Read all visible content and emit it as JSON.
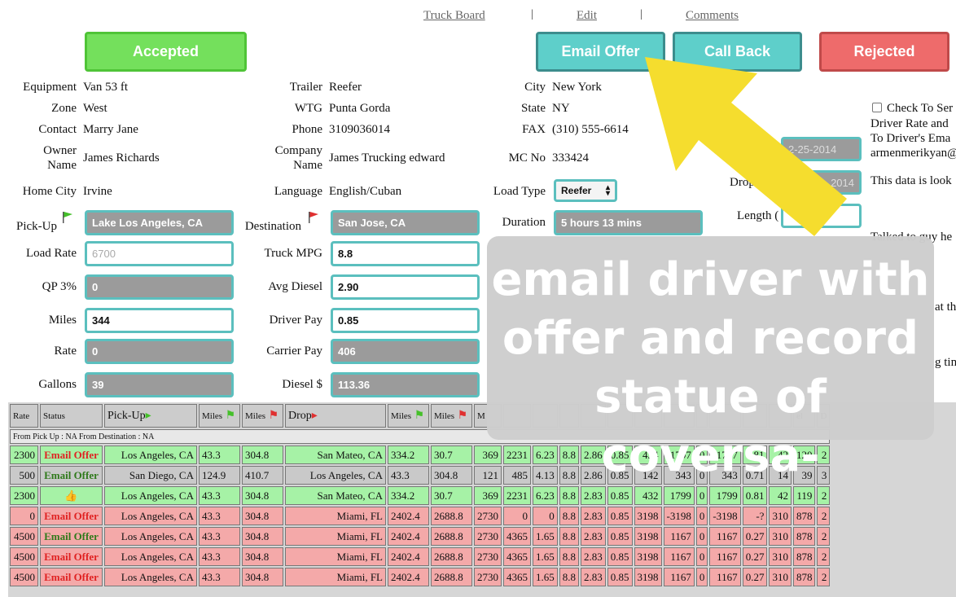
{
  "nav": {
    "truck_board": "Truck Board",
    "edit": "Edit",
    "comments": "Comments",
    "sep": "|"
  },
  "buttons": {
    "accepted": "Accepted",
    "email_offer": "Email Offer",
    "call_back": "Call Back",
    "rejected": "Rejected"
  },
  "colors": {
    "accepted": "#74e05c",
    "teal": "#5ecfca",
    "rejected": "#ee6b6b",
    "arrow": "#f5dd2e"
  },
  "details": {
    "equipment_label": "Equipment",
    "equipment": "Van 53 ft",
    "zone_label": "Zone",
    "zone": "West",
    "contact_label": "Contact",
    "contact": "Marry Jane",
    "owner_label_1": "Owner",
    "owner_label_2": "Name",
    "owner": "James Richards",
    "home_city_label": "Home City",
    "home_city": "Irvine",
    "trailer_label": "Trailer",
    "trailer": "Reefer",
    "wtg_label": "WTG",
    "wtg": "Punta Gorda",
    "phone_label": "Phone",
    "phone": "3109036014",
    "company_label_1": "Company",
    "company_label_2": "Name",
    "company": "James Trucking edward",
    "language_label": "Language",
    "language": "English/Cuban",
    "city_label": "City",
    "city": "New York",
    "state_label": "State",
    "state": "NY",
    "fax_label": "FAX",
    "fax": "(310) 555-6614",
    "mc_label": "MC No",
    "mc": "333424",
    "load_type_label": "Load Type",
    "load_type": "Reefer"
  },
  "form": {
    "pickup_label": "Pick-Up",
    "pickup": "Lake Los Angeles, CA",
    "destination_label": "Destination",
    "destination": "San Jose, CA",
    "duration_label": "Duration",
    "duration": "5 hours 13 mins",
    "load_rate_label": "Load Rate",
    "load_rate_placeholder": "6700",
    "qp_label": "QP 3%",
    "qp": "0",
    "miles_label": "Miles",
    "miles": "344",
    "rate_label": "Rate",
    "rate": "0",
    "gallons_label": "Gallons",
    "gallons": "39",
    "truck_mpg_label": "Truck MPG",
    "truck_mpg": "8.8",
    "avg_diesel_label": "Avg Diesel",
    "avg_diesel": "2.90",
    "driver_pay_label": "Driver Pay",
    "driver_pay": "0.85",
    "carrier_pay_label": "Carrier Pay",
    "carrier_pay": "406",
    "diesel_label": "Diesel $",
    "diesel": "113.36"
  },
  "right_panel": {
    "check_label": "Check To Ser",
    "line2": "Driver Rate and",
    "line3": "To Driver's Ema",
    "line4": "armenmerikyan@",
    "pickup_date": "2-25-2014",
    "drop_label": "Drop",
    "drop_date": "2014",
    "note1": "This data is look",
    "length_label": "Length (",
    "talked": "Talked to guy he",
    "at_th": "at th",
    "g_tim": "g tim"
  },
  "overlay": {
    "line1": "email driver with",
    "line2": "offer and record",
    "line3": "statue of coversa-"
  },
  "table": {
    "headers": [
      "Rate",
      "Status",
      "Pick-Up",
      "Miles",
      "Miles",
      "Drop",
      "Miles",
      "Miles",
      "M",
      "",
      "",
      "",
      "",
      "",
      "",
      "",
      "",
      "",
      "",
      "",
      "el",
      "D"
    ],
    "info": "From Pick Up : NA From Destination : NA",
    "rows": [
      {
        "cls": "green",
        "rate": "2300",
        "status": "Email Offer",
        "st": "red",
        "pickup": "Los Angeles, CA",
        "m1": "43.3",
        "m2": "304.8",
        "drop": "San Mateo, CA",
        "m3": "334.2",
        "m4": "30.7",
        "c1": "369",
        "c2": "2231",
        "c3": "6.23",
        "c4": "8.8",
        "c5": "2.86",
        "c6": "0.85",
        "c7": "434",
        "c8": "1797",
        "c9": "0",
        "c10": "1797",
        "c11": "0.81",
        "c12": "42",
        "c13": "120",
        "c14": "2"
      },
      {
        "cls": "gray",
        "rate": "500",
        "status": "Email Offer",
        "st": "green",
        "pickup": "San Diego, CA",
        "m1": "124.9",
        "m2": "410.7",
        "drop": "Los Angeles, CA",
        "m3": "43.3",
        "m4": "304.8",
        "c1": "121",
        "c2": "485",
        "c3": "4.13",
        "c4": "8.8",
        "c5": "2.86",
        "c6": "0.85",
        "c7": "142",
        "c8": "343",
        "c9": "0",
        "c10": "343",
        "c11": "0.71",
        "c12": "14",
        "c13": "39",
        "c14": "3"
      },
      {
        "cls": "green",
        "rate": "2300",
        "status": "👍",
        "st": "thumb",
        "pickup": "Los Angeles, CA",
        "m1": "43.3",
        "m2": "304.8",
        "drop": "San Mateo, CA",
        "m3": "334.2",
        "m4": "30.7",
        "c1": "369",
        "c2": "2231",
        "c3": "6.23",
        "c4": "8.8",
        "c5": "2.83",
        "c6": "0.85",
        "c7": "432",
        "c8": "1799",
        "c9": "0",
        "c10": "1799",
        "c11": "0.81",
        "c12": "42",
        "c13": "119",
        "c14": "2"
      },
      {
        "cls": "red",
        "rate": "0",
        "status": "Email Offer",
        "st": "red",
        "pickup": "Los Angeles, CA",
        "m1": "43.3",
        "m2": "304.8",
        "drop": "Miami, FL",
        "m3": "2402.4",
        "m4": "2688.8",
        "c1": "2730",
        "c2": "0",
        "c3": "0",
        "c4": "8.8",
        "c5": "2.83",
        "c6": "0.85",
        "c7": "3198",
        "c8": "-3198",
        "c9": "0",
        "c10": "-3198",
        "c11": "-?",
        "c12": "310",
        "c13": "878",
        "c14": "2"
      },
      {
        "cls": "red",
        "rate": "4500",
        "status": "Email Offer",
        "st": "green",
        "pickup": "Los Angeles, CA",
        "m1": "43.3",
        "m2": "304.8",
        "drop": "Miami, FL",
        "m3": "2402.4",
        "m4": "2688.8",
        "c1": "2730",
        "c2": "4365",
        "c3": "1.65",
        "c4": "8.8",
        "c5": "2.83",
        "c6": "0.85",
        "c7": "3198",
        "c8": "1167",
        "c9": "0",
        "c10": "1167",
        "c11": "0.27",
        "c12": "310",
        "c13": "878",
        "c14": "2"
      },
      {
        "cls": "red",
        "rate": "4500",
        "status": "Email Offer",
        "st": "red",
        "pickup": "Los Angeles, CA",
        "m1": "43.3",
        "m2": "304.8",
        "drop": "Miami, FL",
        "m3": "2402.4",
        "m4": "2688.8",
        "c1": "2730",
        "c2": "4365",
        "c3": "1.65",
        "c4": "8.8",
        "c5": "2.83",
        "c6": "0.85",
        "c7": "3198",
        "c8": "1167",
        "c9": "0",
        "c10": "1167",
        "c11": "0.27",
        "c12": "310",
        "c13": "878",
        "c14": "2"
      },
      {
        "cls": "red",
        "rate": "4500",
        "status": "Email Offer",
        "st": "red",
        "pickup": "Los Angeles, CA",
        "m1": "43.3",
        "m2": "304.8",
        "drop": "Miami, FL",
        "m3": "2402.4",
        "m4": "2688.8",
        "c1": "2730",
        "c2": "4365",
        "c3": "1.65",
        "c4": "8.8",
        "c5": "2.83",
        "c6": "0.85",
        "c7": "3198",
        "c8": "1167",
        "c9": "0",
        "c10": "1167",
        "c11": "0.27",
        "c12": "310",
        "c13": "878",
        "c14": "2"
      }
    ]
  }
}
